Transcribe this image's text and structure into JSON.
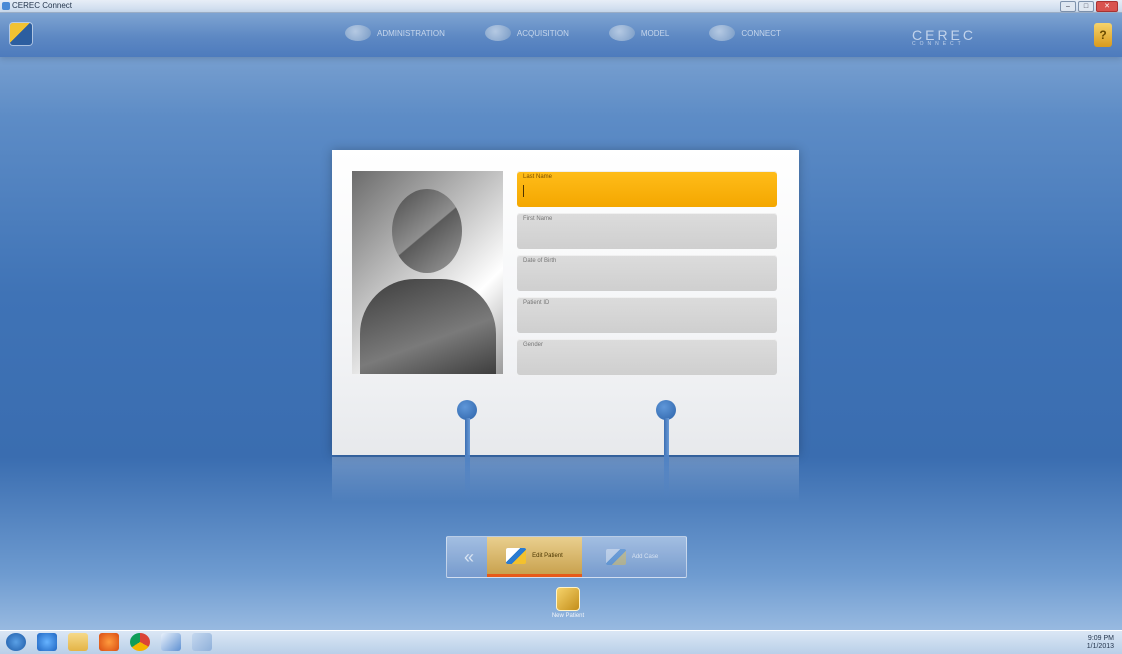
{
  "window": {
    "title": "CEREC Connect",
    "controls": [
      "–",
      "□",
      "✕"
    ]
  },
  "topbar": {
    "steps": [
      {
        "label": "ADMINISTRATION",
        "icon": "administration-icon"
      },
      {
        "label": "ACQUISITION",
        "icon": "acquisition-icon"
      },
      {
        "label": "MODEL",
        "icon": "model-icon"
      },
      {
        "label": "CONNECT",
        "icon": "connect-icon"
      }
    ],
    "brand": "CEREC",
    "brand_sub": "CONNECT",
    "help_label": "?"
  },
  "patient_form": {
    "fields": [
      {
        "label": "Last Name",
        "value": ""
      },
      {
        "label": "First Name",
        "value": ""
      },
      {
        "label": "Date of Birth",
        "value": ""
      },
      {
        "label": "Patient ID",
        "value": ""
      },
      {
        "label": "Gender",
        "value": ""
      }
    ]
  },
  "actions": {
    "back_label": "«",
    "primary_label": "Edit Patient",
    "secondary_label": "Add Case"
  },
  "new_patient": {
    "label": "New Patient"
  },
  "taskbar": {
    "icons": [
      "start-icon",
      "internet-explorer-icon",
      "folder-icon",
      "media-player-icon",
      "chrome-icon",
      "cerec-icon",
      "tool-icon"
    ],
    "time": "9:09 PM",
    "date": "1/1/2013"
  },
  "colors": {
    "accent": "#f4a700",
    "active_underline": "#e65a1a",
    "background": "#3f73b6"
  }
}
